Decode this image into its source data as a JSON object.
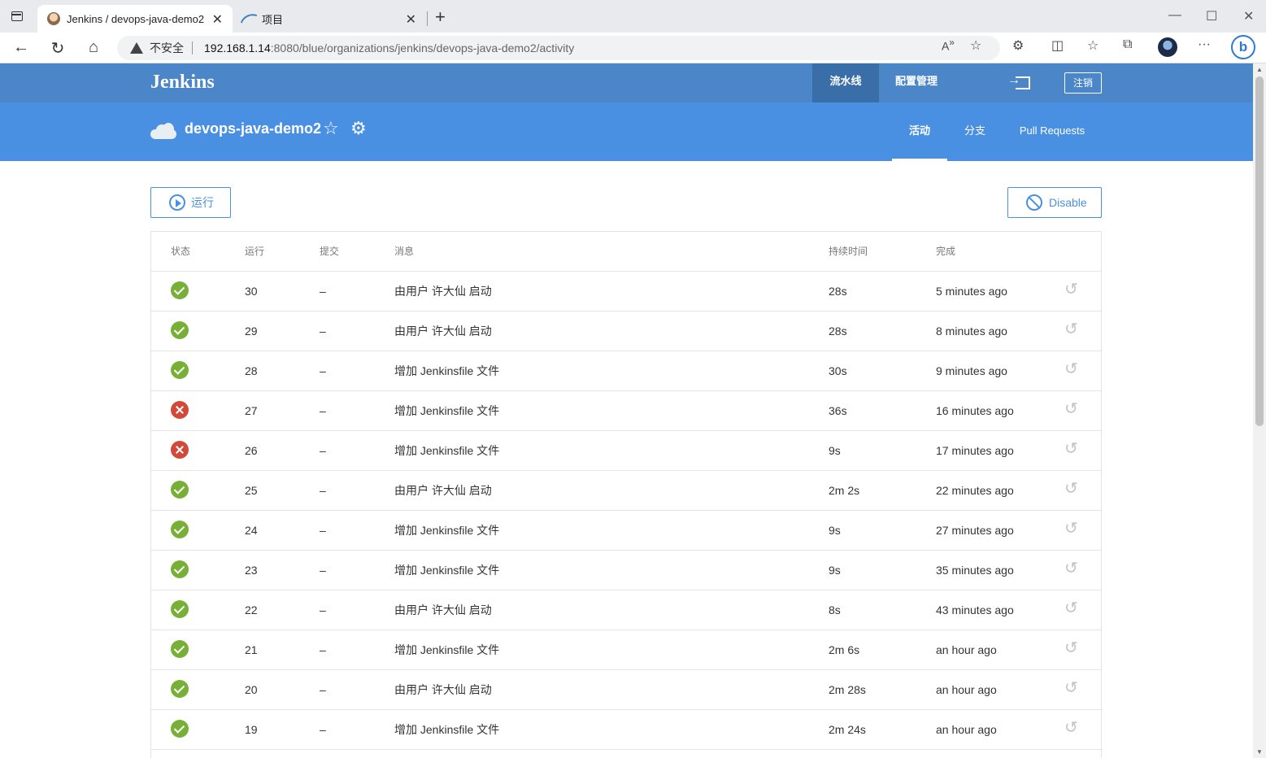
{
  "browser": {
    "tabs": [
      {
        "title": "Jenkins / devops-java-demo2",
        "active": true
      },
      {
        "title": "项目",
        "active": false
      }
    ],
    "close_glyph": "✕",
    "new_tab_glyph": "+",
    "address": {
      "security_label": "不安全",
      "host": "192.168.1.14",
      "path": ":8080/blue/organizations/jenkins/devops-java-demo2/activity"
    }
  },
  "header": {
    "logo": "Jenkins",
    "nav": {
      "pipelines": "流水线",
      "admin": "配置管理"
    },
    "logout": "注销"
  },
  "project": {
    "name": "devops-java-demo2",
    "tabs": {
      "activity": "活动",
      "branches": "分支",
      "pull_requests": "Pull Requests"
    }
  },
  "actions": {
    "run": "运行",
    "disable": "Disable"
  },
  "table": {
    "headers": {
      "status": "状态",
      "run": "运行",
      "commit": "提交",
      "message": "消息",
      "duration": "持续时间",
      "completed": "完成"
    },
    "rows": [
      {
        "status": "success",
        "run": "30",
        "commit": "–",
        "message": "由用户 许大仙 启动",
        "duration": "28s",
        "completed": "5 minutes ago"
      },
      {
        "status": "success",
        "run": "29",
        "commit": "–",
        "message": "由用户 许大仙 启动",
        "duration": "28s",
        "completed": "8 minutes ago"
      },
      {
        "status": "success",
        "run": "28",
        "commit": "–",
        "message": "增加 Jenkinsfile 文件",
        "duration": "30s",
        "completed": "9 minutes ago"
      },
      {
        "status": "failure",
        "run": "27",
        "commit": "–",
        "message": "增加 Jenkinsfile 文件",
        "duration": "36s",
        "completed": "16 minutes ago"
      },
      {
        "status": "failure",
        "run": "26",
        "commit": "–",
        "message": "增加 Jenkinsfile 文件",
        "duration": "9s",
        "completed": "17 minutes ago"
      },
      {
        "status": "success",
        "run": "25",
        "commit": "–",
        "message": "由用户 许大仙 启动",
        "duration": "2m 2s",
        "completed": "22 minutes ago"
      },
      {
        "status": "success",
        "run": "24",
        "commit": "–",
        "message": "增加 Jenkinsfile 文件",
        "duration": "9s",
        "completed": "27 minutes ago"
      },
      {
        "status": "success",
        "run": "23",
        "commit": "–",
        "message": "增加 Jenkinsfile 文件",
        "duration": "9s",
        "completed": "35 minutes ago"
      },
      {
        "status": "success",
        "run": "22",
        "commit": "–",
        "message": "由用户 许大仙 启动",
        "duration": "8s",
        "completed": "43 minutes ago"
      },
      {
        "status": "success",
        "run": "21",
        "commit": "–",
        "message": "增加 Jenkinsfile 文件",
        "duration": "2m 6s",
        "completed": "an hour ago"
      },
      {
        "status": "success",
        "run": "20",
        "commit": "–",
        "message": "由用户 许大仙 启动",
        "duration": "2m 28s",
        "completed": "an hour ago"
      },
      {
        "status": "success",
        "run": "19",
        "commit": "–",
        "message": "增加 Jenkinsfile 文件",
        "duration": "2m 24s",
        "completed": "an hour ago"
      }
    ]
  },
  "colors": {
    "header": "#4a86c8",
    "subheader": "#4a90e2",
    "success": "#78b037",
    "failure": "#d24939"
  }
}
